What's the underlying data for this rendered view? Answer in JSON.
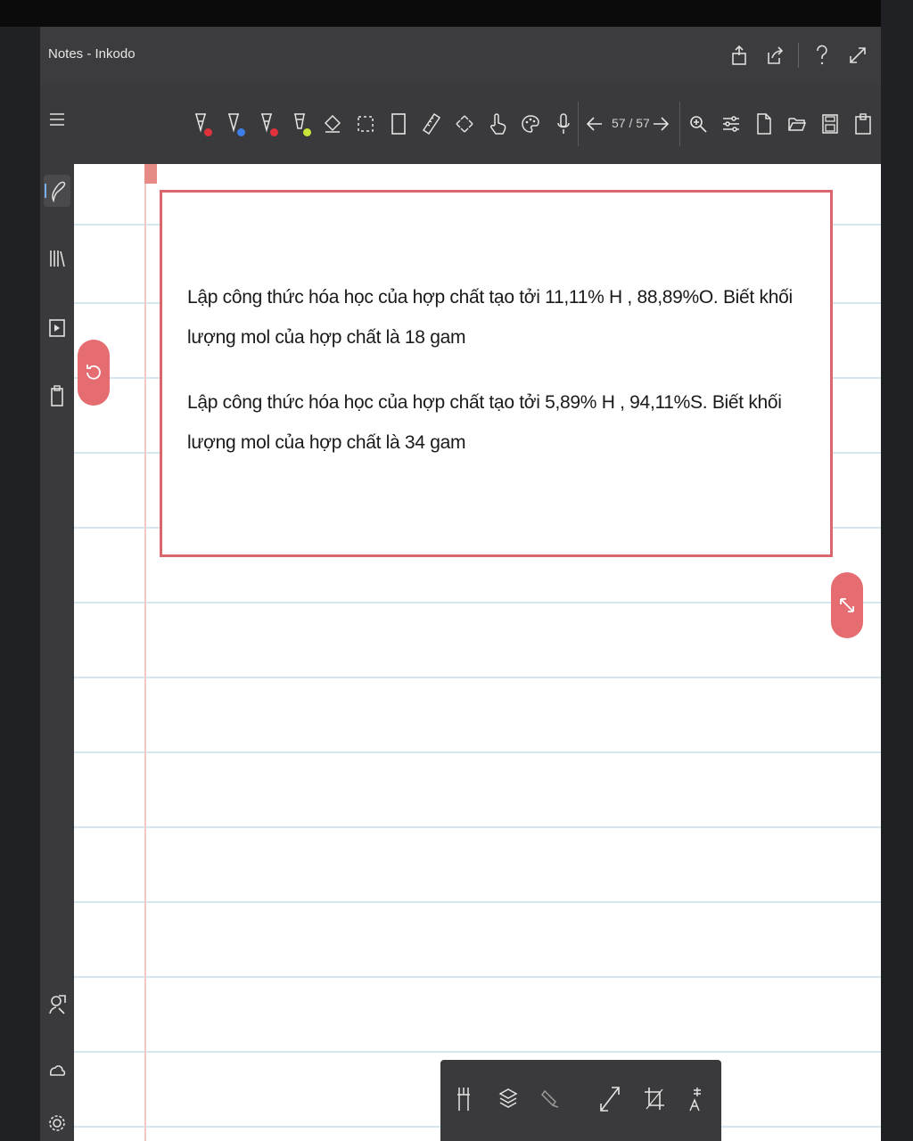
{
  "window": {
    "title": "Notes - Inkodo"
  },
  "titlebar_icons": [
    "share-icon",
    "export-icon",
    "help-icon",
    "fullscreen-icon"
  ],
  "toolbar": {
    "pens": [
      {
        "name": "pen-red",
        "color": "#e0323a"
      },
      {
        "name": "pen-blue",
        "color": "#3d7ee8"
      },
      {
        "name": "pen-red-2",
        "color": "#e0323a"
      },
      {
        "name": "highlighter-yellow",
        "color": "#c8e63a"
      }
    ],
    "page_indicator": "57 / 57"
  },
  "content": {
    "paragraphs": [
      "Lập công thức hóa học của hợp chất tạo tởi 11,11% H , 88,89%O. Biết khối lượng mol của hợp chất là 18 gam",
      "Lập công thức hóa học của hợp chất tạo tởi 5,89% H , 94,11%S. Biết khối lượng mol của hợp chất là 34 gam"
    ]
  },
  "colors": {
    "accent": "#e56c70",
    "box_border": "#d9676d",
    "ruled_line": "#d5e6ee",
    "margin": "#f0c8c2"
  }
}
